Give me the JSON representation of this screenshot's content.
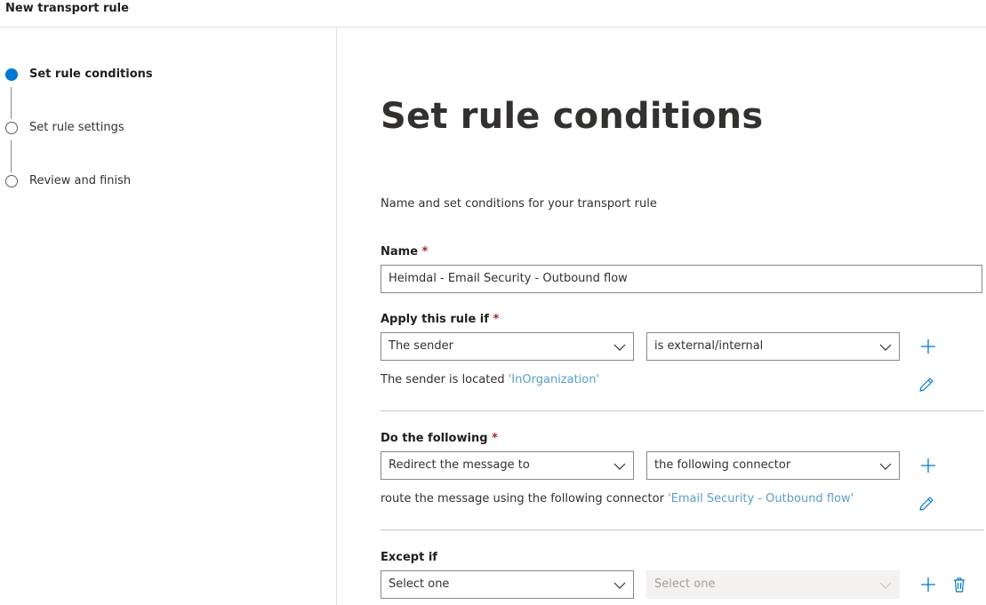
{
  "header": {
    "title": "New transport rule"
  },
  "steps": [
    {
      "label": "Set rule conditions",
      "state": "active"
    },
    {
      "label": "Set rule settings",
      "state": "pending"
    },
    {
      "label": "Review and finish",
      "state": "pending"
    }
  ],
  "main": {
    "title": "Set rule conditions",
    "description": "Name and set conditions for your transport rule",
    "name": {
      "label": "Name",
      "required_mark": "*",
      "value": "Heimdal - Email Security - Outbound flow"
    },
    "apply_if": {
      "label": "Apply this rule if",
      "required_mark": "*",
      "dropdown1": "The sender",
      "dropdown2": "is external/internal",
      "summary_prefix": "The sender is located",
      "summary_link": "'InOrganization'"
    },
    "do_following": {
      "label": "Do the following",
      "required_mark": "*",
      "dropdown1": "Redirect the message to",
      "dropdown2": "the following connector",
      "summary_prefix": "route the message using the following connector",
      "summary_link": "'Email Security - Outbound flow'"
    },
    "except_if": {
      "label": "Except if",
      "dropdown1": "Select one",
      "dropdown2_placeholder": "Select one"
    }
  },
  "colors": {
    "accent": "#0078d4",
    "link": "#5c9ec9",
    "required": "#a4262c",
    "icon": "#0078d4"
  },
  "icons": [
    "chevron-down-icon",
    "add-icon",
    "edit-icon",
    "delete-icon"
  ]
}
